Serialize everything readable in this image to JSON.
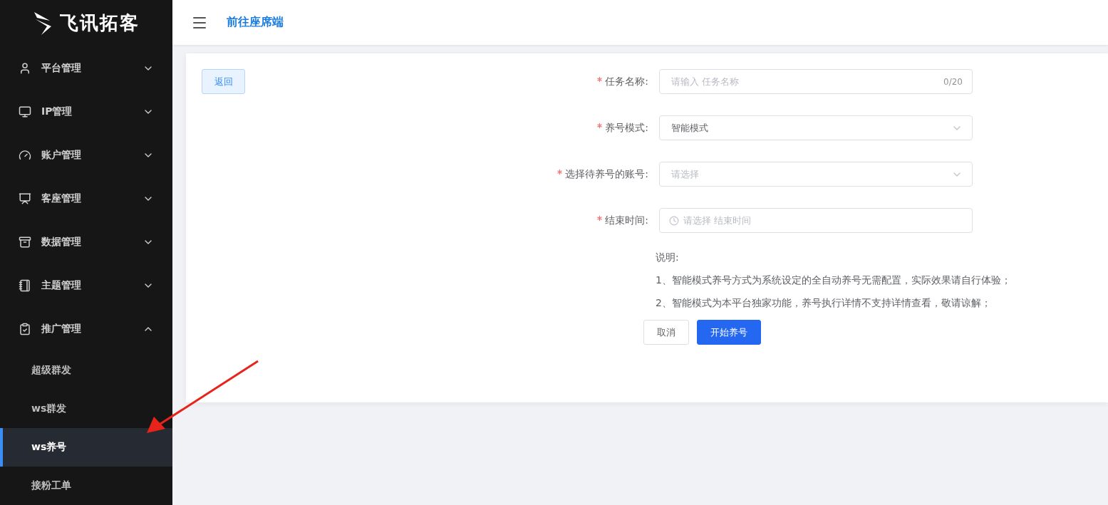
{
  "logo": {
    "text": "飞讯拓客"
  },
  "header": {
    "link": "前往座席端"
  },
  "sidebar": {
    "items": [
      {
        "label": "平台管理",
        "expanded": false
      },
      {
        "label": "IP管理",
        "expanded": false
      },
      {
        "label": "账户管理",
        "expanded": false
      },
      {
        "label": "客座管理",
        "expanded": false
      },
      {
        "label": "数据管理",
        "expanded": false
      },
      {
        "label": "主题管理",
        "expanded": false
      },
      {
        "label": "推广管理",
        "expanded": true,
        "children": [
          {
            "label": "超级群发",
            "selected": false
          },
          {
            "label": "ws群发",
            "selected": false
          },
          {
            "label": "ws养号",
            "selected": true
          },
          {
            "label": "接粉工单",
            "selected": false
          }
        ]
      }
    ]
  },
  "back_button": "返回",
  "form": {
    "fields": [
      {
        "kind": "text",
        "label": "任务名称:",
        "required": true,
        "placeholder": "请输入 任务名称",
        "counter": "0/20"
      },
      {
        "kind": "select",
        "label": "养号模式:",
        "required": true,
        "value": "智能模式"
      },
      {
        "kind": "select",
        "label": "选择待养号的账号:",
        "required": true,
        "placeholder": "请选择"
      },
      {
        "kind": "date",
        "label": "结束时间:",
        "required": true,
        "placeholder": "请选择 结束时间"
      }
    ],
    "notes_title": "说明:",
    "notes": [
      "1、智能模式养号方式为系统设定的全自动养号无需配置，实际效果请自行体验；",
      "2、智能模式为本平台独家功能，养号执行详情不支持详情查看，敬请谅解；"
    ],
    "buttons": [
      {
        "kind": "default",
        "label": "取消"
      },
      {
        "kind": "primary",
        "label": "开始养号"
      }
    ]
  }
}
